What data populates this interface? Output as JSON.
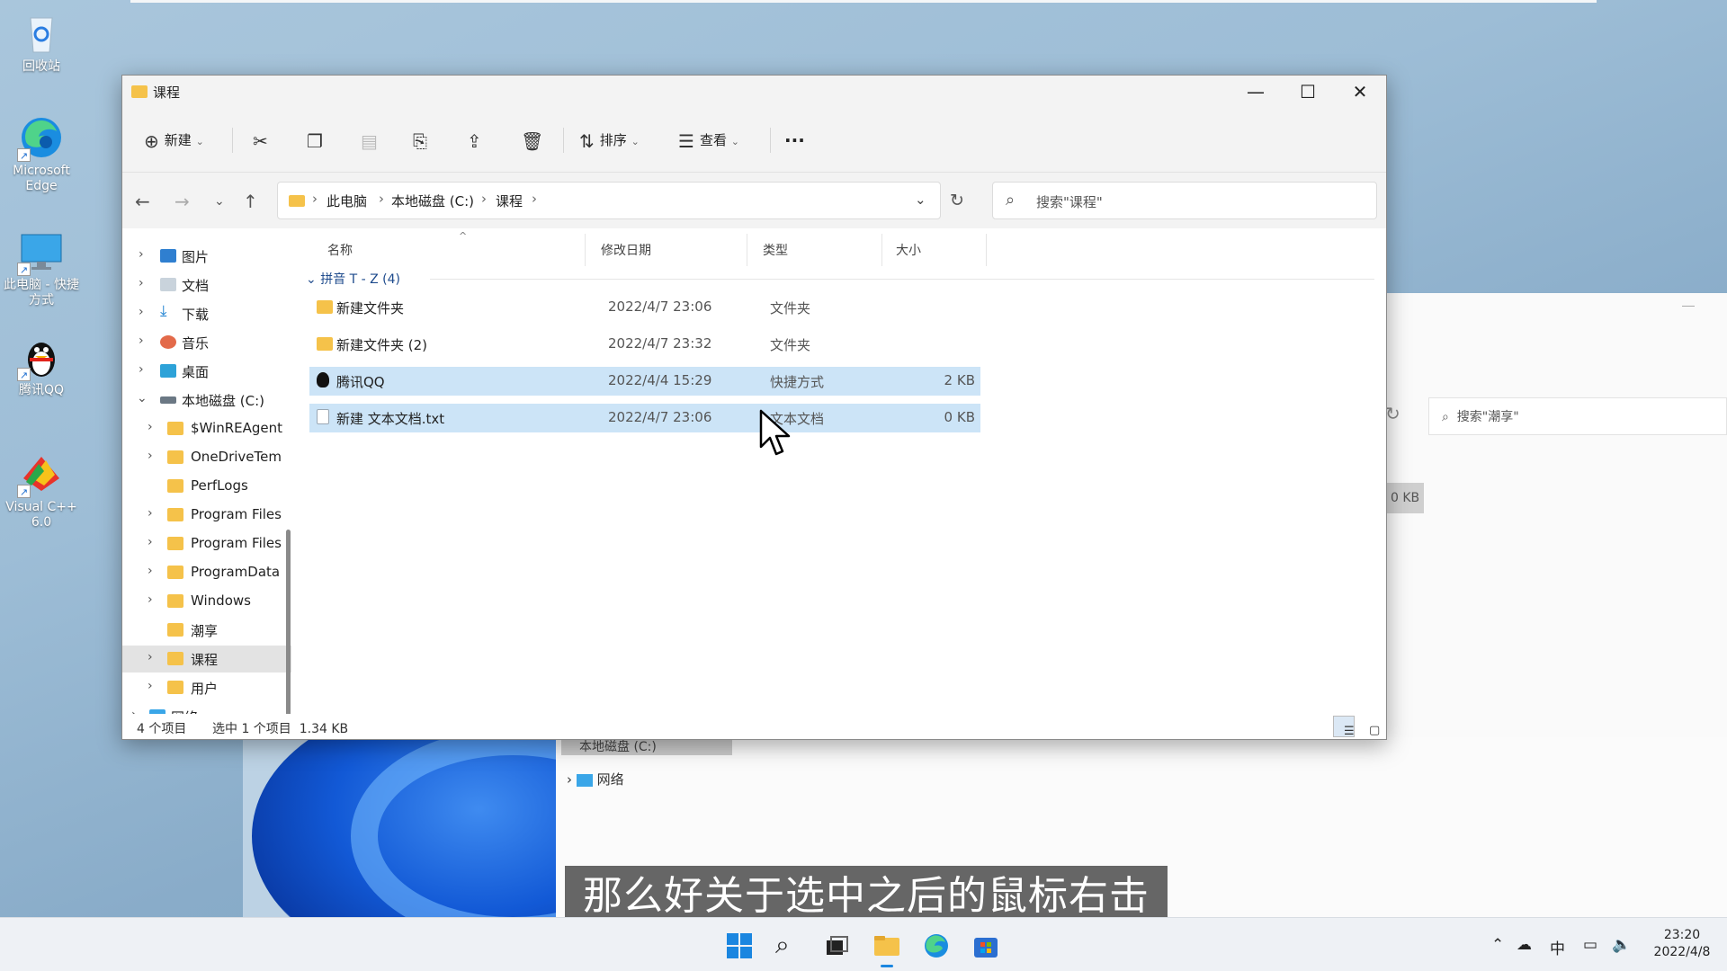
{
  "desktop": {
    "icons": [
      {
        "label": "回收站"
      },
      {
        "label": "Microsoft Edge"
      },
      {
        "label": "此电脑 - 快捷方式"
      },
      {
        "label": "腾讯QQ"
      },
      {
        "label": "Visual C++ 6.0"
      }
    ]
  },
  "background_window": {
    "search_placeholder": "搜索\"潮享\"",
    "size": "0 KB",
    "nav_drive": "本地磁盘 (C:)",
    "nav_network": "网络"
  },
  "window": {
    "title": "课程",
    "controls": {
      "minimize": "—",
      "maximize": "☐",
      "close": "✕"
    },
    "toolbar": {
      "new_label": "新建",
      "sort_label": "排序",
      "view_label": "查看",
      "more": "···"
    },
    "address": {
      "crumbs": [
        "此电脑",
        "本地磁盘 (C:)",
        "课程"
      ],
      "separator": "›"
    },
    "search_placeholder": "搜索\"课程\"",
    "sidebar": {
      "items": [
        {
          "label": "图片"
        },
        {
          "label": "文档"
        },
        {
          "label": "下载"
        },
        {
          "label": "音乐"
        },
        {
          "label": "桌面"
        },
        {
          "label": "本地磁盘 (C:)"
        },
        {
          "label": "$WinREAgent"
        },
        {
          "label": "OneDriveTem"
        },
        {
          "label": "PerfLogs"
        },
        {
          "label": "Program Files"
        },
        {
          "label": "Program Files"
        },
        {
          "label": "ProgramData"
        },
        {
          "label": "Windows"
        },
        {
          "label": "潮享"
        },
        {
          "label": "课程"
        },
        {
          "label": "用户"
        },
        {
          "label": "网络"
        }
      ]
    },
    "columns": {
      "name": "名称",
      "modified": "修改日期",
      "type": "类型",
      "size": "大小"
    },
    "group_label": "拼音 T - Z (4)",
    "files": [
      {
        "name": "新建文件夹",
        "modified": "2022/4/7 23:06",
        "type": "文件夹",
        "size": ""
      },
      {
        "name": "新建文件夹 (2)",
        "modified": "2022/4/7 23:32",
        "type": "文件夹",
        "size": ""
      },
      {
        "name": "腾讯QQ",
        "modified": "2022/4/4 15:29",
        "type": "快捷方式",
        "size": "2 KB"
      },
      {
        "name": "新建 文本文档.txt",
        "modified": "2022/4/7 23:06",
        "type": "文本文档",
        "size": "0 KB"
      }
    ],
    "status": {
      "count": "4 个项目",
      "selection": "选中 1 个项目  1.34 KB"
    }
  },
  "subtitle": "那么好关于选中之后的鼠标右击",
  "taskbar": {
    "tray_ime": "中",
    "time": "23:20",
    "date": "2022/4/8"
  }
}
